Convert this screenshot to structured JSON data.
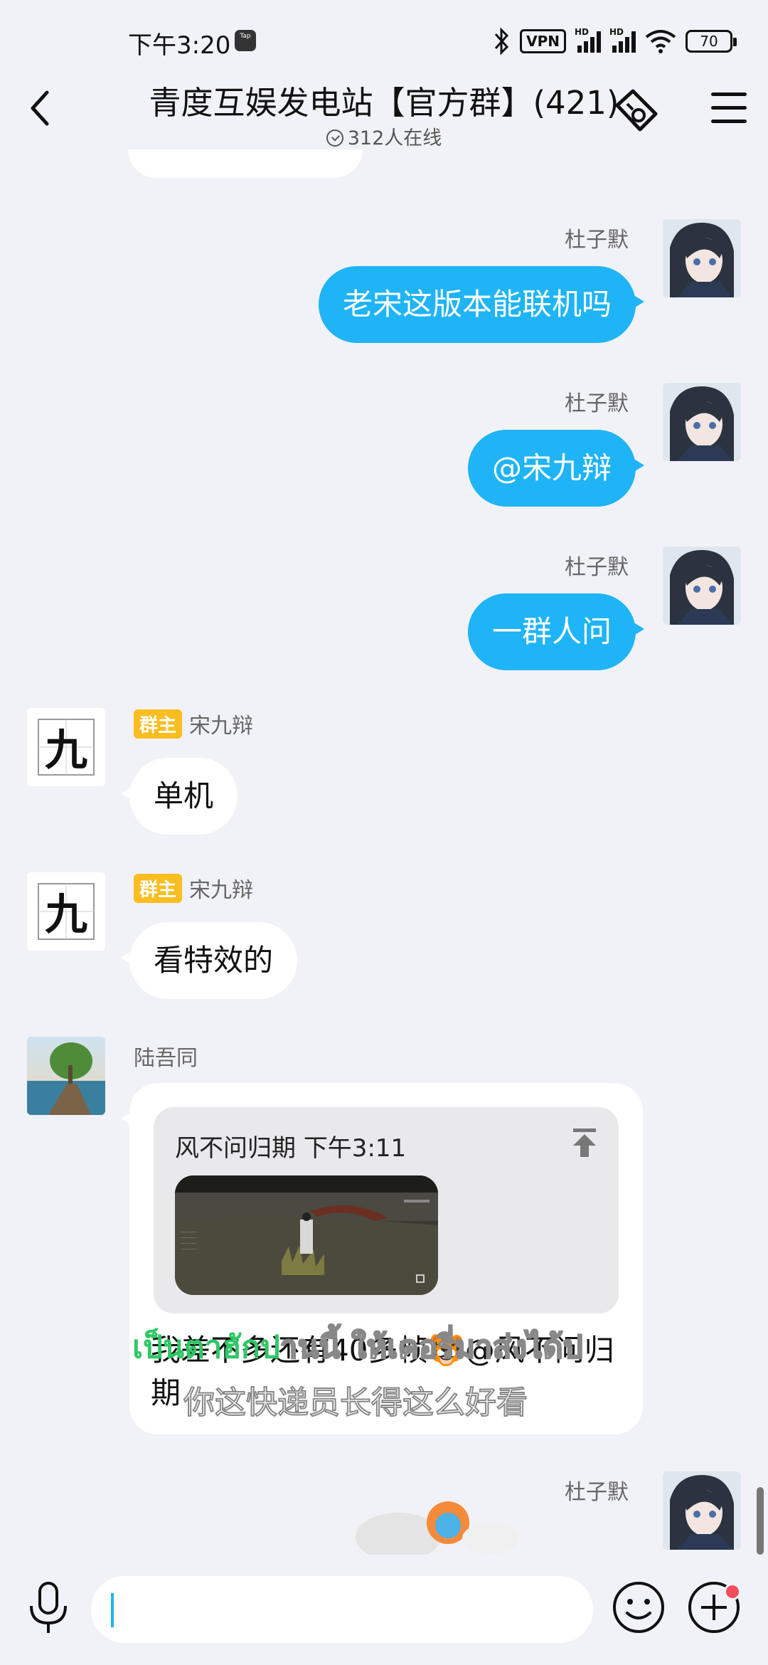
{
  "status_bar": {
    "time": "下午3:20",
    "tap_label": "Tap",
    "vpn": "VPN",
    "hd1": "HD",
    "hd2": "HD",
    "battery": "70"
  },
  "header": {
    "title": "青度互娱发电站【官方群】(421)",
    "online": "312人在线"
  },
  "messages": [
    {
      "sender": "杜子默",
      "text": "老宋这版本能联机吗",
      "direction": "outgoing"
    },
    {
      "sender": "杜子默",
      "text": "@宋九辩",
      "direction": "outgoing"
    },
    {
      "sender": "杜子默",
      "text": "一群人问",
      "direction": "outgoing"
    },
    {
      "badge": "群主",
      "sender": "宋九辩",
      "text": "单机",
      "direction": "incoming",
      "avatar_char": "九"
    },
    {
      "badge": "群主",
      "sender": "宋九辩",
      "text": "看特效的",
      "direction": "incoming",
      "avatar_char": "九"
    },
    {
      "sender": "陆吾同",
      "direction": "incoming",
      "quote_author": "风不问归期",
      "quote_time": "下午3:11",
      "text": "我差不多还有40多帧🐯@风不问归期"
    },
    {
      "sender": "杜子默",
      "direction": "outgoing"
    }
  ],
  "overlay": {
    "thai_green": "เป็นตาฮักป",
    "thai_white": "านนี้ ให้เคอรี่มาส่งได้ป",
    "chinese": "你这快递员长得这么好看"
  },
  "colors": {
    "outgoing_bubble": "#1fb4f5",
    "owner_badge": "#fbbd1f",
    "background": "#f1f2f7",
    "notification_dot": "#f44d5b"
  },
  "icons": {
    "back": "chevron-left-icon",
    "menu": "hamburger-menu-icon",
    "mic": "microphone-icon",
    "emoji": "smiley-icon",
    "plus": "plus-circle-icon"
  }
}
